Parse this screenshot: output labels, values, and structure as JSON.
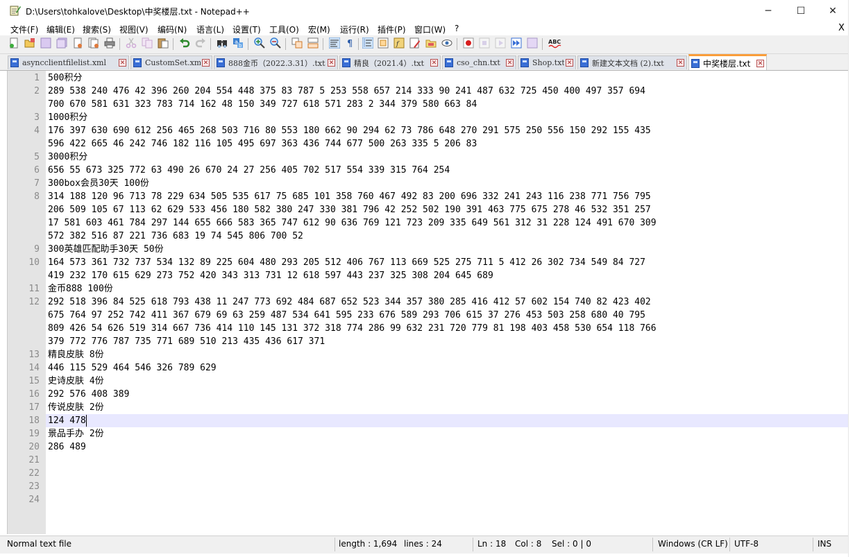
{
  "window": {
    "title": "D:\\Users\\tohkalove\\Desktop\\中奖楼层.txt - Notepad++",
    "minimize": "─",
    "maximize": "☐",
    "close": "✕"
  },
  "menu": [
    "文件(F)",
    "编辑(E)",
    "搜索(S)",
    "视图(V)",
    "编码(N)",
    "语言(L)",
    "设置(T)",
    "工具(O)",
    "宏(M)",
    "运行(R)",
    "插件(P)",
    "窗口(W)",
    "?"
  ],
  "menu_close": "X",
  "toolbar": {
    "icons": [
      "new-file-icon",
      "open-file-icon",
      "save-icon",
      "save-all-icon",
      "close-icon",
      "close-all-icon",
      "print-icon",
      "cut-icon",
      "copy-icon",
      "paste-icon",
      "undo-icon",
      "redo-icon",
      "find-icon",
      "replace-icon",
      "zoom-in-icon",
      "zoom-out-icon",
      "sync-vertical-icon",
      "sync-horizontal-icon",
      "word-wrap-icon",
      "show-all-chars-icon",
      "indent-guide-icon",
      "doc-map-icon",
      "function-list-icon",
      "folder-workspace-icon",
      "monitor-icon",
      "record-macro-icon",
      "stop-record-icon",
      "play-macro-icon",
      "run-macro-multiple-icon",
      "save-macro-icon",
      "spell-check-icon"
    ]
  },
  "tabs": [
    {
      "label": "asyncclientfilelist.xml",
      "active": false
    },
    {
      "label": "CustomSet.xml",
      "active": false
    },
    {
      "label": "888金币（2022.3.31）.txt",
      "active": false
    },
    {
      "label": "精良（2021.4）.txt",
      "active": false
    },
    {
      "label": "cso_chn.txt",
      "active": false
    },
    {
      "label": "Shop.txt",
      "active": false
    },
    {
      "label": "新建文本文档 (2).txt",
      "active": false
    },
    {
      "label": "中奖楼层.txt",
      "active": true
    }
  ],
  "tab_close": "✕",
  "editor": {
    "current_line": 18,
    "lines": [
      {
        "n": "1",
        "text": [
          "500积分"
        ]
      },
      {
        "n": "2",
        "text": [
          "289 538 240 476 42 396 260 204 554 448 375 83 787 5 253 558 657 214 333 90 241 487 632 725 450 400 497 357 694",
          "700 670 581 631 323 783 714 162 48 150 349 727 618 571 283 2 344 379 580 663 84"
        ]
      },
      {
        "n": "3",
        "text": [
          "1000积分"
        ]
      },
      {
        "n": "4",
        "text": [
          "176 397 630 690 612 256 465 268 503 716 80 553 180 662 90 294 62 73 786 648 270 291 575 250 556 150 292 155 435",
          "596 422 665 46 242 746 182 116 105 495 697 363 436 744 677 500 263 335 5 206 83"
        ]
      },
      {
        "n": "5",
        "text": [
          "3000积分"
        ]
      },
      {
        "n": "6",
        "text": [
          "656 55 673 325 772 63 490 26 670 24 27 256 405 702 517 554 339 315 764 254"
        ]
      },
      {
        "n": "7",
        "text": [
          "300box会员30天 100份"
        ]
      },
      {
        "n": "8",
        "text": [
          "314 188 120 96 713 78 229 634 505 535 617 75 685 101 358 760 467 492 83 200 696 332 241 243 116 238 771 756 795",
          "206 509 105 67 113 62 629 533 456 180 582 380 247 330 381 796 42 252 502 190 391 463 775 675 278 46 532 351 257",
          "17 581 603 461 784 297 144 655 666 583 365 747 612 90 636 769 121 723 209 335 649 561 312 31 228 124 491 670 309",
          "572 382 516 87 221 736 683 19 74 545 806 700 52"
        ]
      },
      {
        "n": "9",
        "text": [
          "300英雄匹配助手30天 50份"
        ]
      },
      {
        "n": "10",
        "text": [
          "164 573 361 732 737 534 132 89 225 604 480 293 205 512 406 767 113 669 525 275 711 5 412 26 302 734 549 84 727",
          "419 232 170 615 629 273 752 420 343 313 731 12 618 597 443 237 325 308 204 645 689"
        ]
      },
      {
        "n": "11",
        "text": [
          "金币888 100份"
        ]
      },
      {
        "n": "12",
        "text": [
          "292 518 396 84 525 618 793 438 11 247 773 692 484 687 652 523 344 357 380 285 416 412 57 602 154 740 82 423 402",
          "675 764 97 252 742 411 367 679 69 63 259 487 534 641 595 233 676 589 293 706 615 37 276 453 503 258 680 40 795",
          "809 426 54 626 519 314 667 736 414 110 145 131 372 318 774 286 99 632 231 720 779 81 198 403 458 530 654 118 766",
          "379 772 776 787 735 771 689 510 213 435 436 617 371"
        ]
      },
      {
        "n": "13",
        "text": [
          "精良皮肤 8份"
        ]
      },
      {
        "n": "14",
        "text": [
          "446 115 529 464 546 326 789 629"
        ]
      },
      {
        "n": "15",
        "text": [
          "史诗皮肤 4份"
        ]
      },
      {
        "n": "16",
        "text": [
          "292 576 408 389"
        ]
      },
      {
        "n": "17",
        "text": [
          "传说皮肤 2份"
        ]
      },
      {
        "n": "18",
        "text": [
          "124 478"
        ]
      },
      {
        "n": "19",
        "text": [
          "景品手办 2份"
        ]
      },
      {
        "n": "20",
        "text": [
          "286 489"
        ]
      },
      {
        "n": "21",
        "text": [
          ""
        ]
      },
      {
        "n": "22",
        "text": [
          ""
        ]
      },
      {
        "n": "23",
        "text": [
          ""
        ]
      },
      {
        "n": "24",
        "text": [
          ""
        ]
      }
    ]
  },
  "status": {
    "file_type": "Normal text file",
    "length": "length : 1,694",
    "lines": "lines : 24",
    "ln": "Ln : 18",
    "col": "Col : 8",
    "sel": "Sel : 0 | 0",
    "eol": "Windows (CR LF)",
    "encoding": "UTF-8",
    "mode": "INS"
  }
}
